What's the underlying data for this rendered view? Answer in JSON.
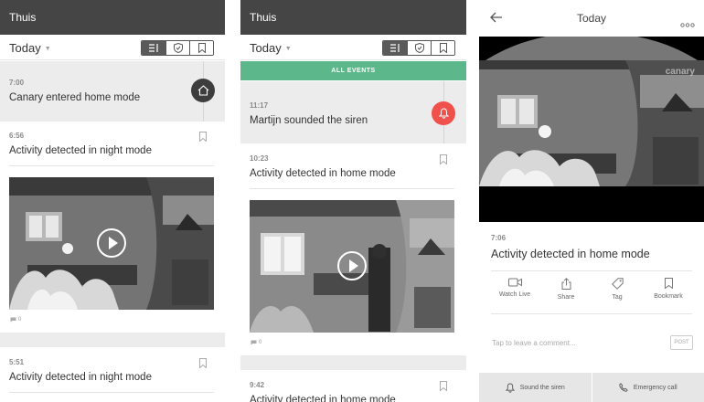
{
  "screen1": {
    "title": "Thuis",
    "filter_label": "Today",
    "events": [
      {
        "time": "7:00",
        "description": "Canary entered home mode"
      },
      {
        "time": "6:56",
        "description": "Activity detected in night mode",
        "comments": "0"
      },
      {
        "time": "5:51",
        "description": "Activity detected in night mode"
      }
    ]
  },
  "screen2": {
    "title": "Thuis",
    "filter_label": "Today",
    "banner": "ALL EVENTS",
    "events": [
      {
        "time": "11:17",
        "description": "Martijn sounded the siren"
      },
      {
        "time": "10:23",
        "description": "Activity detected in home mode",
        "comments": "0"
      },
      {
        "time": "9:42",
        "description": "Activity detected in home mode"
      }
    ]
  },
  "screen3": {
    "title": "Today",
    "watermark": "canary",
    "event_time": "7:06",
    "event_description": "Activity detected in home mode",
    "actions": [
      "Watch Live",
      "Share",
      "Tag",
      "Bookmark"
    ],
    "comment_placeholder": "Tap to leave a comment...",
    "post_label": "POST",
    "sound_siren_label": "Sound the siren",
    "emergency_label": "Emergency call"
  },
  "colors": {
    "topbar": "#454545",
    "accent_green": "#5cb88a",
    "siren_red": "#f0514a",
    "mode_dark": "#3d3d3d",
    "highlight_gray": "#ececec"
  },
  "icons": [
    "list-icon",
    "shield-icon",
    "bookmark-icon",
    "home-icon",
    "bell-icon",
    "play-icon",
    "comment-icon",
    "back-arrow-icon",
    "more-icon",
    "video-camera-icon",
    "share-icon",
    "tag-icon",
    "phone-icon"
  ]
}
